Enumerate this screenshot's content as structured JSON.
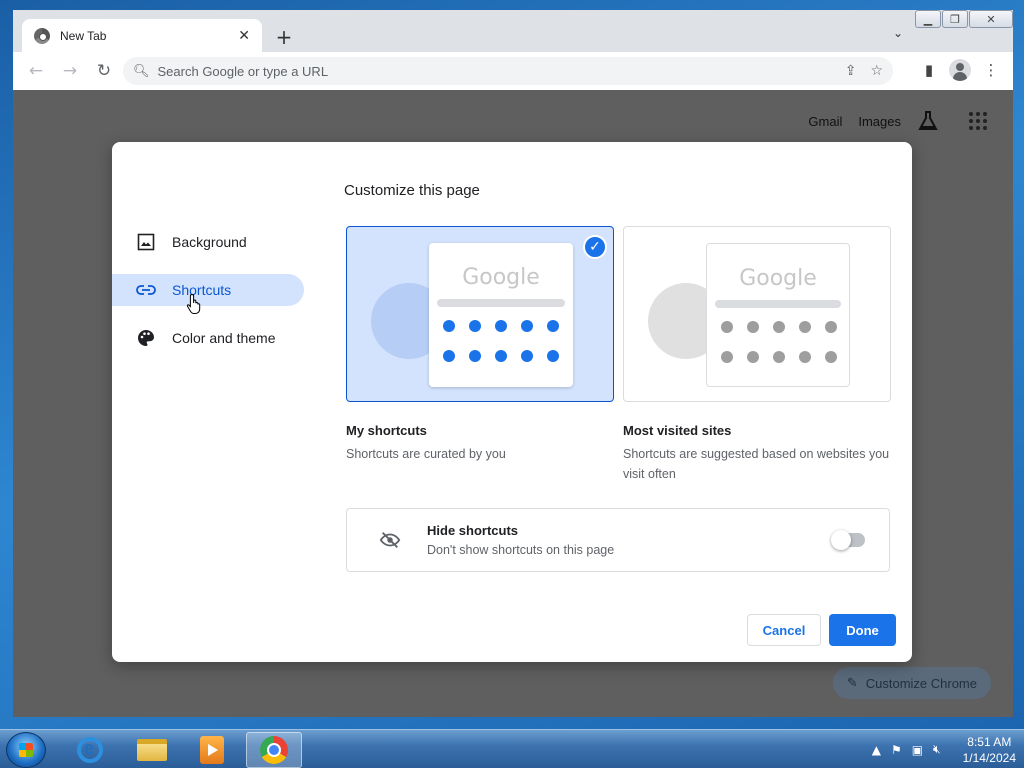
{
  "tab": {
    "title": "New Tab",
    "close": "✕",
    "new_tab": "+",
    "search_tabs": "⌄"
  },
  "window_controls": {
    "minimize": "▁",
    "restore": "❐",
    "close": "✕"
  },
  "toolbar": {
    "back": "←",
    "forward": "→",
    "reload": "↻",
    "omnibox_placeholder": "Search Google or type a URL"
  },
  "page": {
    "links": [
      "Gmail",
      "Images"
    ],
    "customize_chrome": "Customize Chrome"
  },
  "dialog": {
    "title": "Customize this page",
    "sidebar": [
      {
        "label": "Background",
        "icon": "image-icon"
      },
      {
        "label": "Shortcuts",
        "icon": "link-icon",
        "selected": true
      },
      {
        "label": "Color and theme",
        "icon": "palette-icon"
      }
    ],
    "options": [
      {
        "title": "My shortcuts",
        "description": "Shortcuts are curated by you",
        "logo": "Google",
        "selected": true
      },
      {
        "title": "Most visited sites",
        "description": "Shortcuts are suggested based on websites you visit often",
        "logo": "Google",
        "selected": false
      }
    ],
    "hide_shortcuts": {
      "title": "Hide shortcuts",
      "subtitle": "Don't show shortcuts on this page",
      "enabled": false
    },
    "buttons": {
      "cancel": "Cancel",
      "done": "Done"
    }
  },
  "taskbar": {
    "time": "8:51 AM",
    "date": "1/14/2024"
  },
  "colors": {
    "accent": "#1a73e8",
    "selected_bg": "#d3e3fd",
    "scrim": "#5f5f60"
  }
}
